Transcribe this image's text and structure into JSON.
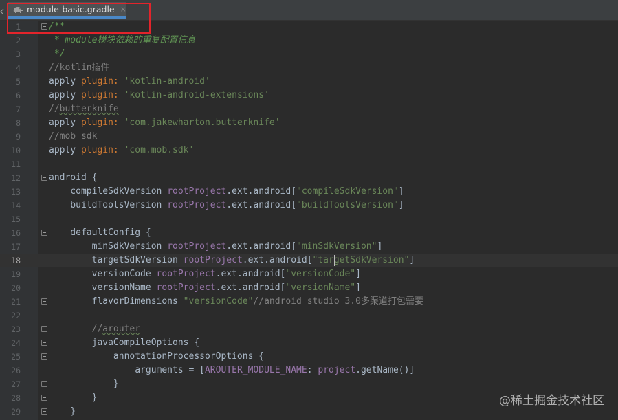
{
  "tab": {
    "title": "module-basic.gradle",
    "close": "×",
    "icon": "gradle-elephant-icon"
  },
  "watermark": "@稀土掘金技术社区",
  "lines": [
    {
      "n": "1",
      "html": "<span class=\"c-doc\">/**</span>",
      "fold": true
    },
    {
      "n": "2",
      "html": "<span class=\"c-doc\"> * module模块依赖的重复配置信息</span>"
    },
    {
      "n": "3",
      "html": "<span class=\"c-doc\"> */</span>"
    },
    {
      "n": "4",
      "html": "<span class=\"c-com\">//kotlin插件</span>"
    },
    {
      "n": "5",
      "html": "apply <span class=\"c-kw\">plugin: </span><span class=\"c-str\">'kotlin-android'</span>"
    },
    {
      "n": "6",
      "html": "apply <span class=\"c-kw\">plugin: </span><span class=\"c-str\">'kotlin-android-extensions'</span>"
    },
    {
      "n": "7",
      "html": "<span class=\"c-com\">//<span class=\"wavy\">butterknife</span></span>"
    },
    {
      "n": "8",
      "html": "apply <span class=\"c-kw\">plugin: </span><span class=\"c-str\">'com.jakewharton.butterknife'</span>"
    },
    {
      "n": "9",
      "html": "<span class=\"c-com\">//mob sdk</span>"
    },
    {
      "n": "10",
      "html": "apply <span class=\"c-kw\">plugin: </span><span class=\"c-str\">'com.mob.sdk'</span>"
    },
    {
      "n": "11",
      "html": ""
    },
    {
      "n": "12",
      "html": "android {",
      "fold": true
    },
    {
      "n": "13",
      "html": "    compileSdkVersion <span class=\"c-fld\">rootProject</span>.ext.android[<span class=\"c-str\">\"compileSdkVersion\"</span>]"
    },
    {
      "n": "14",
      "html": "    buildToolsVersion <span class=\"c-fld\">rootProject</span>.ext.android[<span class=\"c-str\">\"buildToolsVersion\"</span>]"
    },
    {
      "n": "15",
      "html": ""
    },
    {
      "n": "16",
      "html": "    defaultConfig {",
      "fold": true
    },
    {
      "n": "17",
      "html": "        minSdkVersion <span class=\"c-fld\">rootProject</span>.ext.android[<span class=\"c-str\">\"minSdkVersion\"</span>]"
    },
    {
      "n": "18",
      "html": "        targetSdkVersion <span class=\"c-fld\">rootProject</span>.ext.android[<span class=\"c-str\">\"targetSdkVersion\"</span>]",
      "current": true
    },
    {
      "n": "19",
      "html": "        versionCode <span class=\"c-fld\">rootProject</span>.ext.android[<span class=\"c-str\">\"versionCode\"</span>]"
    },
    {
      "n": "20",
      "html": "        versionName <span class=\"c-fld\">rootProject</span>.ext.android[<span class=\"c-str\">\"versionName\"</span>]"
    },
    {
      "n": "21",
      "html": "        flavorDimensions <span class=\"c-str\">\"versionCode\"</span><span class=\"c-com\">//android studio 3.0多渠道打包需要</span>",
      "fold": true
    },
    {
      "n": "22",
      "html": ""
    },
    {
      "n": "23",
      "html": "        <span class=\"c-com\">//<span class=\"wavy\">arouter</span></span>",
      "fold": true
    },
    {
      "n": "24",
      "html": "        javaCompileOptions {",
      "fold": true
    },
    {
      "n": "25",
      "html": "            annotationProcessorOptions {",
      "fold": true
    },
    {
      "n": "26",
      "html": "                arguments = [<span class=\"c-fld\">AROUTER_MODULE_NAME</span>: <span class=\"c-fld\">project</span>.getName()]"
    },
    {
      "n": "27",
      "html": "            }",
      "fold": true
    },
    {
      "n": "28",
      "html": "        }",
      "fold": true
    },
    {
      "n": "29",
      "html": "    }",
      "fold": true
    }
  ]
}
